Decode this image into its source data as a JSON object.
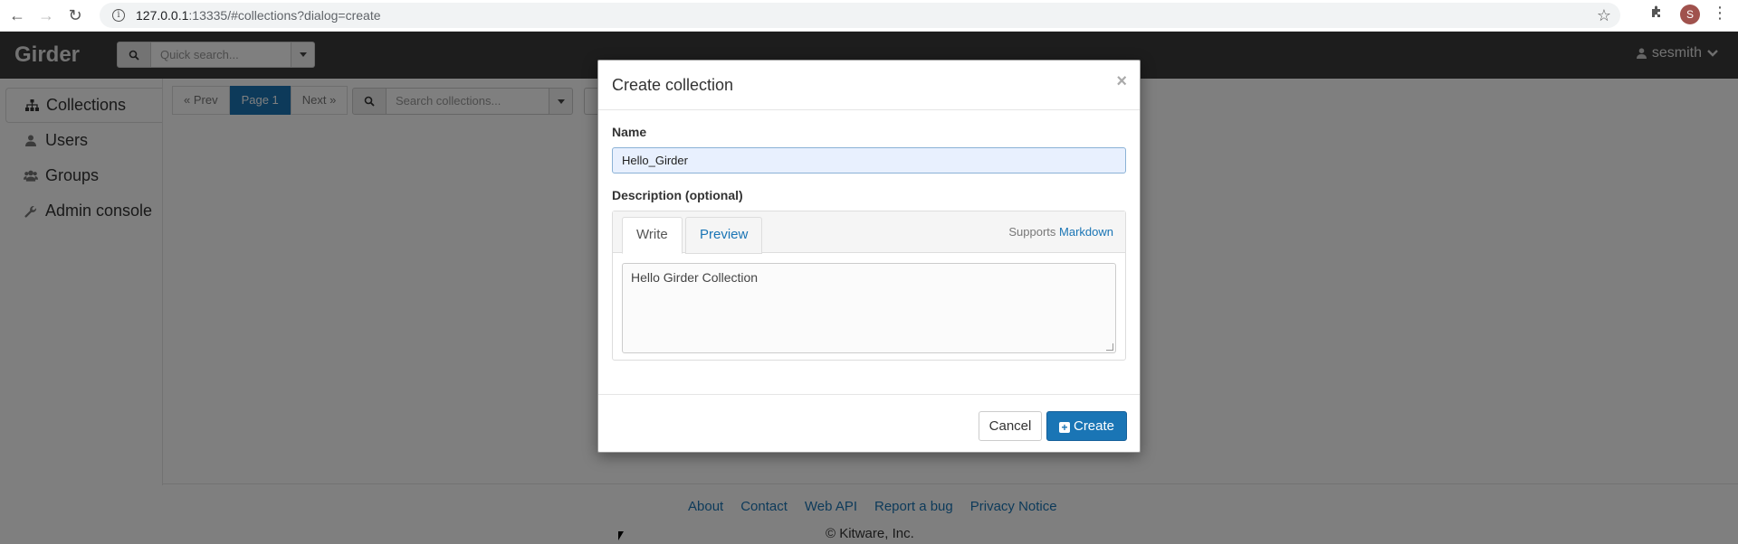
{
  "browser": {
    "url_host": "127.0.0.1",
    "url_rest": ":13335/#collections?dialog=create",
    "profile_initial": "S"
  },
  "header": {
    "brand": "Girder",
    "quick_search_placeholder": "Quick search...",
    "username": "sesmith"
  },
  "sidebar": {
    "items": [
      {
        "label": "Collections",
        "icon": "sitemap-icon"
      },
      {
        "label": "Users",
        "icon": "user-icon"
      },
      {
        "label": "Groups",
        "icon": "users-icon"
      },
      {
        "label": "Admin console",
        "icon": "wrench-icon"
      }
    ]
  },
  "toolbar": {
    "prev": "« Prev",
    "page": "Page 1",
    "next": "Next »",
    "search_placeholder": "Search collections..."
  },
  "modal": {
    "title": "Create collection",
    "close": "×",
    "name_label": "Name",
    "name_value": "Hello_Girder",
    "description_label": "Description (optional)",
    "tab_write": "Write",
    "tab_preview": "Preview",
    "supports_text": "Supports",
    "markdown_link": "Markdown",
    "description_value": "Hello Girder Collection",
    "cancel": "Cancel",
    "create": "Create"
  },
  "footer": {
    "links": [
      "About",
      "Contact",
      "Web API",
      "Report a bug",
      "Privacy Notice"
    ],
    "copyright": "© Kitware, Inc."
  },
  "colors": {
    "accent": "#1a75b5",
    "header_bg": "#3b3b3b"
  }
}
